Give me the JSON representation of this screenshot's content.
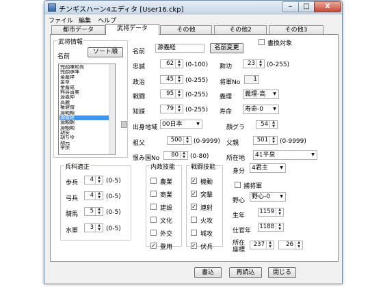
{
  "window": {
    "title": "チンギスハーン4エディタ [User16.ckp]"
  },
  "titlebar_buttons": {
    "minimize": "–",
    "maximize": "□",
    "close": "X"
  },
  "menu": [
    "ファイル",
    "編集",
    "ヘルプ"
  ],
  "tabs": [
    "都市データ",
    "武将データ",
    "その他",
    "その他2",
    "その他3"
  ],
  "active_tab": "武将データ",
  "general_info": {
    "title": "武将情報",
    "name_label": "名前",
    "sort_button": "ソート順",
    "list": [
      "完顔陳和尚",
      "完顔承暉",
      "金履祥",
      "金章",
      "金履戒",
      "熊谷直実",
      "源義仲",
      "高麗",
      "権健僧",
      "源範頼",
      "源義経",
      "源頼朝",
      "源頼朝",
      "胡安",
      "胡ちゆ",
      "胡元",
      "李宗"
    ],
    "selected_index": 10
  },
  "fields": {
    "name_label": "名前",
    "name_value": "源義経",
    "name_change_button": "名前変更",
    "transfer_label": "書換対象",
    "loyalty_label": "忠誠",
    "loyalty_value": "62",
    "loyalty_range": "(0-100)",
    "merit_label": "勲功",
    "merit_value": "23",
    "merit_range": "(0-255)",
    "politics_label": "政治",
    "politics_value": "45",
    "politics_range": "(0-255)",
    "general_no_label": "将軍No",
    "general_no_value": "1",
    "war_label": "戦闘",
    "war_value": "95",
    "war_range": "(0-255)",
    "righteous_label": "義理",
    "righteous_value": "義理-高",
    "intelligence_label": "知謀",
    "intelligence_value": "79",
    "intelligence_range": "(0-255)",
    "lifespan_label": "寿命",
    "lifespan_value": "寿命-0",
    "origin_label": "出身地域",
    "origin_value": "00日本",
    "face_label": "顔グラ",
    "face_value": "54",
    "grandfather_label": "祖父",
    "grandfather_value": "500",
    "grandfather_range": "(0-9999)",
    "father_label": "父親",
    "father_value": "501",
    "father_range": "(0-9999)",
    "grudge_label": "恨み国No",
    "grudge_value": "80",
    "grudge_range": "(0-80)",
    "location_label": "所在地",
    "location_value": "41平泉"
  },
  "soldier_skills": {
    "title": "兵科適正",
    "items": [
      {
        "label": "歩兵",
        "value": "4",
        "range": "(0-5)"
      },
      {
        "label": "弓兵",
        "value": "4",
        "range": "(0-5)"
      },
      {
        "label": "騎馬",
        "value": "5",
        "range": "(0-5)"
      },
      {
        "label": "水軍",
        "value": "3",
        "range": "(0-5)"
      }
    ]
  },
  "domestic_skills": {
    "title": "内政技能",
    "items": [
      {
        "label": "農業",
        "checked": false
      },
      {
        "label": "商業",
        "checked": false
      },
      {
        "label": "建設",
        "checked": false
      },
      {
        "label": "文化",
        "checked": false
      },
      {
        "label": "外交",
        "checked": false
      },
      {
        "label": "登用",
        "checked": true
      }
    ]
  },
  "war_skills": {
    "title": "戦闘技能",
    "items": [
      {
        "label": "機動",
        "checked": true
      },
      {
        "label": "突撃",
        "checked": true
      },
      {
        "label": "連射",
        "checked": true
      },
      {
        "label": "火攻",
        "checked": false
      },
      {
        "label": "城攻",
        "checked": false
      },
      {
        "label": "伏兵",
        "checked": true
      }
    ]
  },
  "status": {
    "rank_label": "身分",
    "rank_value": "4君主",
    "confinement_label": "捕将軍",
    "confinement_checked": false,
    "ambition_label": "野心",
    "ambition_value": "野心-0",
    "birth_label": "生年",
    "birth_value": "1159",
    "service_label": "仕官年",
    "service_value": "1188",
    "coord_label_1": "所在",
    "coord_label_2": "座標",
    "coord_x": "237",
    "coord_y": "26"
  },
  "footer": {
    "write_button": "書込",
    "reload_button": "再読込",
    "close_button": "閉じる"
  }
}
